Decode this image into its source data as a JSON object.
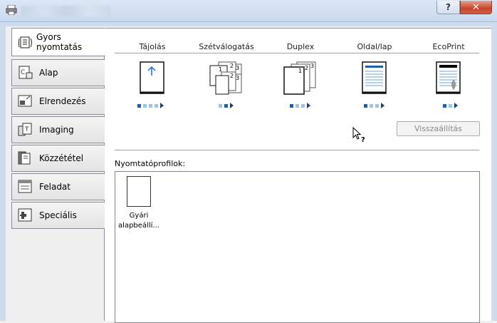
{
  "window": {
    "help_label": "?",
    "close_label": "✕"
  },
  "sidebar": {
    "tabs": [
      {
        "label_line1": "Gyors",
        "label_line2": "nyomtatás",
        "icon": "quick-print-icon",
        "active": true
      },
      {
        "label": "Alap",
        "icon": "basic-icon"
      },
      {
        "label": "Elrendezés",
        "icon": "layout-icon"
      },
      {
        "label": "Imaging",
        "icon": "imaging-icon"
      },
      {
        "label": "Közzététel",
        "icon": "publishing-icon"
      },
      {
        "label": "Feladat",
        "icon": "job-icon"
      },
      {
        "label": "Speciális",
        "icon": "advanced-icon"
      }
    ]
  },
  "features": {
    "orientation": "Tájolás",
    "collate": "Szétválogatás",
    "duplex": "Duplex",
    "pages_per_sheet": "Oldal/lap",
    "ecoprint": "EcoPrint"
  },
  "reset_label": "Visszaállítás",
  "profiles": {
    "label": "Nyomtatóprofilok:",
    "items": [
      {
        "name_line1": "Gyári",
        "name_line2": "alapbeállí..."
      }
    ]
  },
  "colors": {
    "accent": "#1c5fb0",
    "close": "#c7432b"
  }
}
